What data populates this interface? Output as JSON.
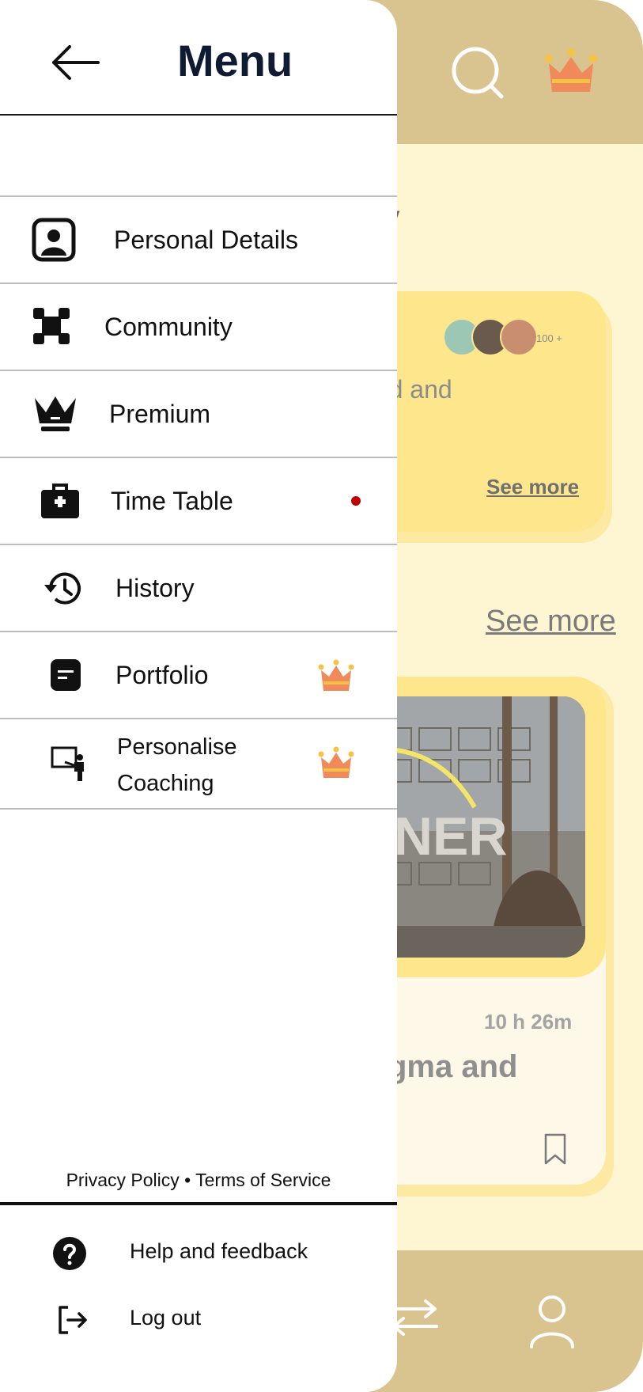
{
  "drawer": {
    "title": "Menu",
    "items": [
      {
        "label": "Personal Details",
        "icon": "user-card-icon"
      },
      {
        "label": "Community",
        "icon": "community-icon"
      },
      {
        "label": "Premium",
        "icon": "crown-icon"
      },
      {
        "label": "Time Table",
        "icon": "briefcase-icon",
        "notification": true
      },
      {
        "label": "History",
        "icon": "history-icon"
      },
      {
        "label": "Portfolio",
        "icon": "document-icon",
        "premium": true
      },
      {
        "label_line1": "Personalise",
        "label_line2": "Coaching",
        "icon": "teacher-board-icon",
        "premium": true
      }
    ],
    "legal": "Privacy Policy • Terms of Service",
    "help_label": "Help and feedback",
    "logout_label": "Log out"
  },
  "background_app": {
    "heading_fragment": "v",
    "card1": {
      "avatar_count": "100 +",
      "text_fragment": "shed and",
      "see_more": "See more"
    },
    "section_see_more": "See more",
    "card2": {
      "image_text": "GNER",
      "duration": "10 h 26m",
      "title_fragment": "gma  and"
    }
  },
  "colors": {
    "header_bg": "#d9c48f",
    "app_bg": "#fef6d2",
    "card_yellow": "#fde68c",
    "crown_orange": "#f08a5a",
    "crown_gold": "#f6c244",
    "notification_dot": "#c00000",
    "menu_title": "#0f1a33"
  }
}
